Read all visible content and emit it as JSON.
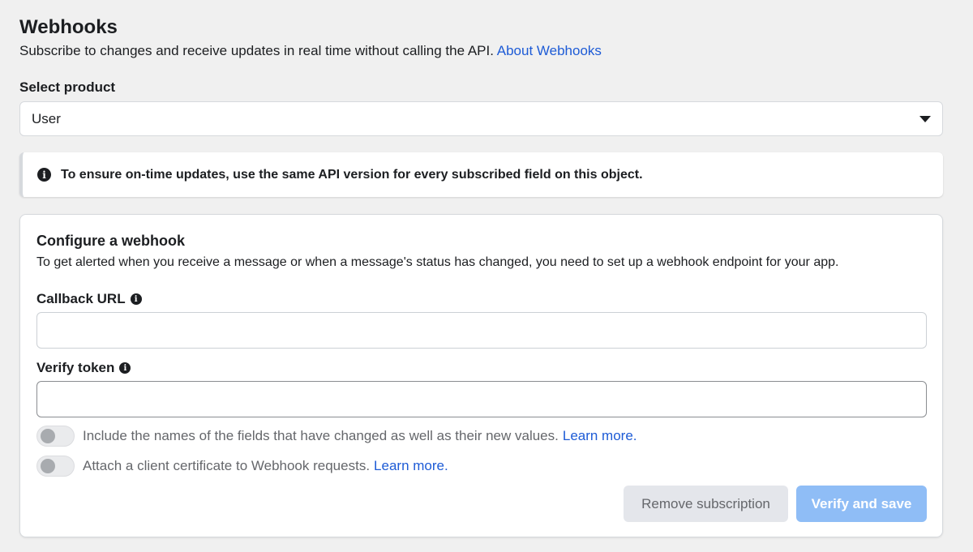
{
  "header": {
    "title": "Webhooks",
    "subtitle": "Subscribe to changes and receive updates in real time without calling the API.",
    "about_link": "About Webhooks"
  },
  "product_select": {
    "label": "Select product",
    "selected": "User"
  },
  "notice": {
    "icon": "info-icon",
    "text": "To ensure on-time updates, use the same API version for every subscribed field on this object."
  },
  "configure": {
    "title": "Configure a webhook",
    "description": "To get alerted when you receive a message or when a message's status has changed, you need to set up a webhook endpoint for your app.",
    "callback_url": {
      "label": "Callback URL",
      "value": "",
      "placeholder": ""
    },
    "verify_token": {
      "label": "Verify token",
      "value": "",
      "placeholder": ""
    },
    "toggles": [
      {
        "text": "Include the names of the fields that have changed as well as their new values.",
        "link": "Learn more",
        "suffix": ".",
        "on": false
      },
      {
        "text": "Attach a client certificate to Webhook requests.",
        "link": "Learn more",
        "suffix": ".",
        "on": false
      }
    ],
    "buttons": {
      "remove": "Remove subscription",
      "save": "Verify and save"
    }
  },
  "colors": {
    "link": "#1d5bd6",
    "primary_disabled": "#8fbdf6",
    "secondary_bg": "#e4e6eb",
    "page_bg": "#f0f0f0"
  }
}
